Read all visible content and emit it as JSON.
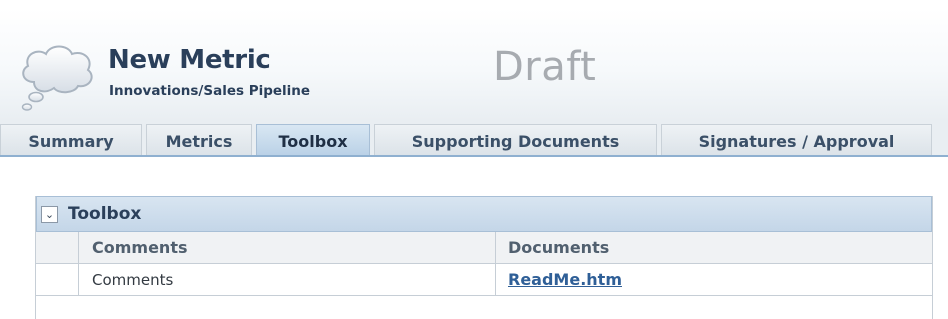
{
  "header": {
    "title": "New Metric",
    "subtitle": "Innovations/Sales Pipeline",
    "status": "Draft",
    "logo_icon": "thought-bubble-icon"
  },
  "tabs": [
    {
      "label": "Summary",
      "active": false
    },
    {
      "label": "Metrics",
      "active": false
    },
    {
      "label": "Toolbox",
      "active": true
    },
    {
      "label": "Supporting Documents",
      "active": false
    },
    {
      "label": "Signatures / Approval",
      "active": false
    }
  ],
  "toolbox": {
    "title": "Toolbox",
    "collapse_icon": "chevron-down-icon",
    "columns": [
      "Comments",
      "Documents"
    ],
    "rows": [
      {
        "comments": "Comments",
        "document": "ReadMe.htm"
      }
    ]
  },
  "colors": {
    "title_text": "#2a3f5a",
    "status_text": "#a7abb0",
    "active_tab": "#b9d0e6",
    "link": "#2f5f97"
  }
}
